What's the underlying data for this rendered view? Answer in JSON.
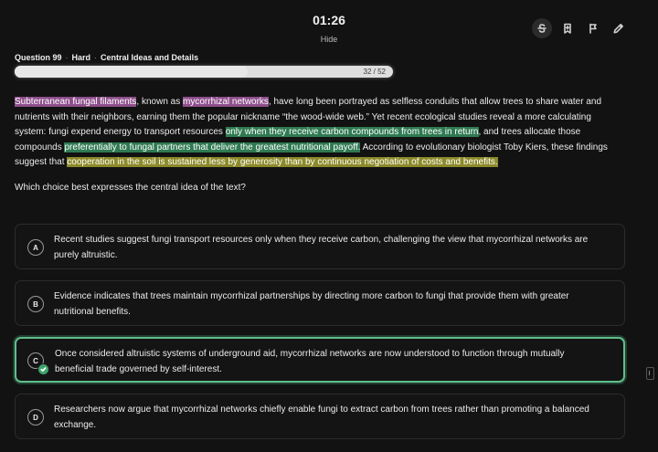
{
  "timer": {
    "value": "01:26",
    "hide_label": "Hide"
  },
  "toolbar": {
    "icons": [
      "strikethrough-icon",
      "bookmark-plus-icon",
      "flag-icon",
      "pencil-icon"
    ]
  },
  "meta": {
    "question": "Question 99",
    "difficulty": "Hard",
    "category": "Central Ideas and Details"
  },
  "progress": {
    "label": "32 / 52",
    "fraction": 0.615
  },
  "passage": {
    "segments": [
      {
        "text": "Subterranean fungal filaments",
        "hl": "purple"
      },
      {
        "text": ", known as ",
        "hl": ""
      },
      {
        "text": "mycorrhizal networks",
        "hl": "purple"
      },
      {
        "text": ", have long been portrayed as selfless conduits that allow trees to share water and nutrients with their neighbors, earning them the popular nickname “the wood-wide web.” Yet recent ecological studies reveal a more calculating system: fungi expend energy to transport resources ",
        "hl": ""
      },
      {
        "text": "only when they receive carbon compounds from trees in return",
        "hl": "green"
      },
      {
        "text": ", and trees allocate those compounds ",
        "hl": ""
      },
      {
        "text": "preferentially to fungal partners that deliver the greatest nutritional payoff.",
        "hl": "green"
      },
      {
        "text": " According to evolutionary biologist Toby Kiers, these findings suggest that ",
        "hl": ""
      },
      {
        "text": "cooperation in the soil is sustained less by generosity than by continuous negotiation of costs and benefits.",
        "hl": "olive"
      }
    ]
  },
  "question_text": "Which choice best expresses the central idea of the text?",
  "choices": [
    {
      "letter": "A",
      "text": "Recent studies suggest fungi transport resources only when they receive carbon, challenging the view that mycorrhizal networks are purely altruistic."
    },
    {
      "letter": "B",
      "text": "Evidence indicates that trees maintain mycorrhizal partnerships by directing more carbon to fungi that provide them with greater nutritional benefits."
    },
    {
      "letter": "C",
      "text": "Once considered altruistic systems of underground aid, mycorrhizal networks are now understood to function through mutually beneficial trade governed by self-interest."
    },
    {
      "letter": "D",
      "text": "Researchers now argue that mycorrhizal networks chiefly enable fungi to extract carbon from trees rather than promoting a balanced exchange."
    }
  ],
  "selected_choice": "C",
  "colors": {
    "highlight_purple": "#8e4f8c",
    "highlight_green": "#2f7a52",
    "highlight_olive": "#8c8a2a",
    "selected_border": "#5fbf8b"
  }
}
